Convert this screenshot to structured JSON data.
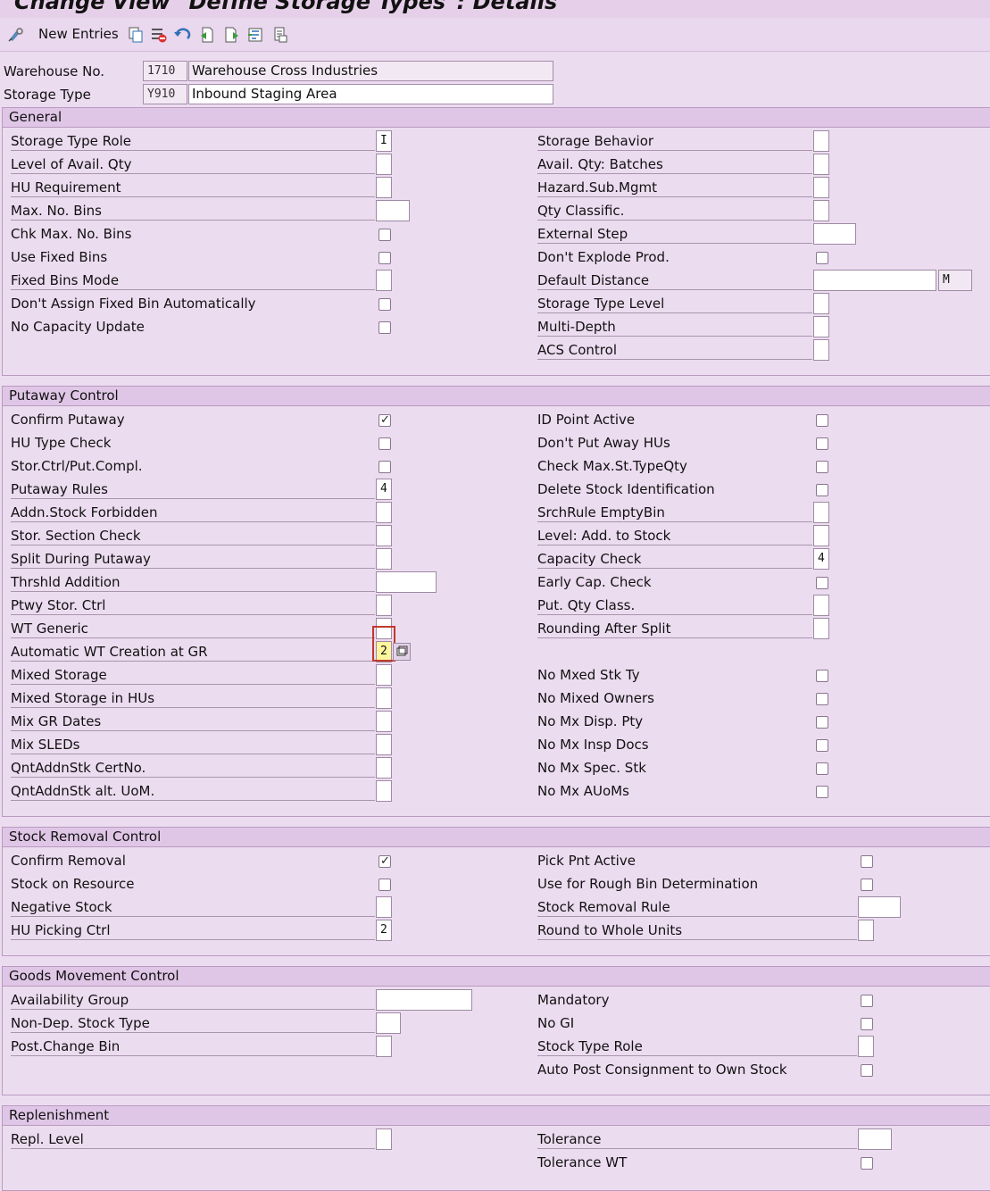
{
  "window": {
    "title": "Change View \"Define Storage Types\": Details"
  },
  "toolbar": {
    "new_entries": "New Entries",
    "icons": [
      "display-change-icon",
      "copy-icon",
      "delete-icon",
      "undo-icon",
      "previous-entry-icon",
      "next-entry-icon",
      "select-all-icon",
      "print-icon"
    ]
  },
  "header": {
    "warehouse_label": "Warehouse No.",
    "warehouse_code": "1710",
    "warehouse_desc": "Warehouse Cross Industries",
    "storage_type_label": "Storage Type",
    "storage_type_code": "Y910",
    "storage_type_desc": "Inbound Staging Area"
  },
  "general": {
    "title": "General",
    "storage_type_role": {
      "label": "Storage Type Role",
      "value": "I"
    },
    "level_avail_qty": {
      "label": "Level of Avail. Qty",
      "value": ""
    },
    "hu_requirement": {
      "label": "HU Requirement",
      "value": ""
    },
    "max_no_bins": {
      "label": "Max. No. Bins",
      "value": ""
    },
    "chk_max_no_bins": {
      "label": "Chk Max. No. Bins",
      "checked": false
    },
    "use_fixed_bins": {
      "label": "Use Fixed Bins",
      "checked": false
    },
    "fixed_bins_mode": {
      "label": "Fixed Bins Mode",
      "value": ""
    },
    "dont_assign_fixed_bin": {
      "label": "Don't Assign Fixed Bin Automatically",
      "checked": false
    },
    "no_capacity_update": {
      "label": "No Capacity Update",
      "checked": false
    },
    "storage_behavior": {
      "label": "Storage Behavior",
      "value": ""
    },
    "avail_qty_batches": {
      "label": "Avail. Qty: Batches",
      "value": ""
    },
    "hazard_sub_mgmt": {
      "label": "Hazard.Sub.Mgmt",
      "value": ""
    },
    "qty_classific": {
      "label": "Qty Classific.",
      "value": ""
    },
    "external_step": {
      "label": "External Step",
      "value": ""
    },
    "dont_explode_prod": {
      "label": "Don't Explode Prod.",
      "checked": false
    },
    "default_distance": {
      "label": "Default Distance",
      "value": "",
      "unit": "M"
    },
    "storage_type_level": {
      "label": "Storage Type Level",
      "value": ""
    },
    "multi_depth": {
      "label": "Multi-Depth",
      "value": ""
    },
    "acs_control": {
      "label": "ACS Control",
      "value": ""
    }
  },
  "putaway": {
    "title": "Putaway Control",
    "confirm_putaway": {
      "label": "Confirm Putaway",
      "checked": true
    },
    "hu_type_check": {
      "label": "HU Type Check",
      "checked": false
    },
    "stor_ctrl_put_compl": {
      "label": "Stor.Ctrl/Put.Compl.",
      "checked": false
    },
    "putaway_rules": {
      "label": "Putaway Rules",
      "value": "4"
    },
    "addn_stock_forbidden": {
      "label": "Addn.Stock Forbidden",
      "value": ""
    },
    "stor_section_check": {
      "label": "Stor. Section Check",
      "value": ""
    },
    "split_during_putaway": {
      "label": "Split During Putaway",
      "value": ""
    },
    "thrshld_addition": {
      "label": "Thrshld Addition",
      "value": ""
    },
    "ptwy_stor_ctrl": {
      "label": "Ptwy Stor. Ctrl",
      "value": ""
    },
    "wt_generic": {
      "label": "WT Generic",
      "value": ""
    },
    "auto_wt_creation_gr": {
      "label": "Automatic WT Creation at GR",
      "value": "2"
    },
    "mixed_storage": {
      "label": "Mixed Storage",
      "value": ""
    },
    "mixed_storage_hus": {
      "label": "Mixed Storage in HUs",
      "value": ""
    },
    "mix_gr_dates": {
      "label": "Mix GR Dates",
      "value": ""
    },
    "mix_sleds": {
      "label": "Mix SLEDs",
      "value": ""
    },
    "qntaddnstk_certno": {
      "label": "QntAddnStk CertNo.",
      "value": ""
    },
    "qntaddnstk_alt_uom": {
      "label": "QntAddnStk alt. UoM.",
      "value": ""
    },
    "id_point_active": {
      "label": "ID Point Active",
      "checked": false
    },
    "dont_put_away_hus": {
      "label": "Don't Put Away HUs",
      "checked": false
    },
    "check_max_st_typeqty": {
      "label": "Check Max.St.TypeQty",
      "checked": false
    },
    "delete_stock_id": {
      "label": "Delete Stock Identification",
      "checked": false
    },
    "srchrule_emptybin": {
      "label": "SrchRule EmptyBin",
      "value": ""
    },
    "level_add_to_stock": {
      "label": "Level: Add. to Stock",
      "value": ""
    },
    "capacity_check": {
      "label": "Capacity Check",
      "value": "4"
    },
    "early_cap_check": {
      "label": "Early Cap. Check",
      "checked": false
    },
    "put_qty_class": {
      "label": "Put. Qty Class.",
      "value": ""
    },
    "rounding_after_split": {
      "label": "Rounding After Split",
      "value": ""
    },
    "no_mxed_stk_ty": {
      "label": "No Mxed Stk Ty",
      "checked": false
    },
    "no_mixed_owners": {
      "label": "No Mixed Owners",
      "checked": false
    },
    "no_mx_disp_pty": {
      "label": "No Mx Disp. Pty",
      "checked": false
    },
    "no_mx_insp_docs": {
      "label": "No Mx Insp Docs",
      "checked": false
    },
    "no_mx_spec_stk": {
      "label": "No Mx Spec. Stk",
      "checked": false
    },
    "no_mx_auoms": {
      "label": "No Mx AUoMs",
      "checked": false
    }
  },
  "stock_removal": {
    "title": "Stock Removal Control",
    "confirm_removal": {
      "label": "Confirm Removal",
      "checked": true
    },
    "stock_on_resource": {
      "label": "Stock on Resource",
      "checked": false
    },
    "negative_stock": {
      "label": "Negative Stock",
      "value": ""
    },
    "hu_picking_ctrl": {
      "label": "HU Picking Ctrl",
      "value": "2"
    },
    "pick_pnt_active": {
      "label": "Pick Pnt Active",
      "checked": false
    },
    "use_rough_bin": {
      "label": "Use for Rough Bin Determination",
      "checked": false
    },
    "stock_removal_rule": {
      "label": "Stock Removal Rule",
      "value": ""
    },
    "round_whole_units": {
      "label": "Round to Whole Units",
      "value": ""
    }
  },
  "goods_movement": {
    "title": "Goods Movement Control",
    "availability_group": {
      "label": "Availability Group",
      "value": ""
    },
    "non_dep_stock_type": {
      "label": "Non-Dep. Stock Type",
      "value": ""
    },
    "post_change_bin": {
      "label": "Post.Change Bin",
      "value": ""
    },
    "mandatory": {
      "label": "Mandatory",
      "checked": false
    },
    "no_gi": {
      "label": "No GI",
      "checked": false
    },
    "stock_type_role": {
      "label": "Stock Type Role",
      "value": ""
    },
    "auto_post_consignment": {
      "label": "Auto Post Consignment to Own Stock",
      "checked": false
    }
  },
  "replenishment": {
    "title": "Replenishment",
    "repl_level": {
      "label": "Repl. Level",
      "value": ""
    },
    "tolerance": {
      "label": "Tolerance",
      "value": ""
    },
    "tolerance_wt": {
      "label": "Tolerance WT",
      "checked": false
    }
  }
}
